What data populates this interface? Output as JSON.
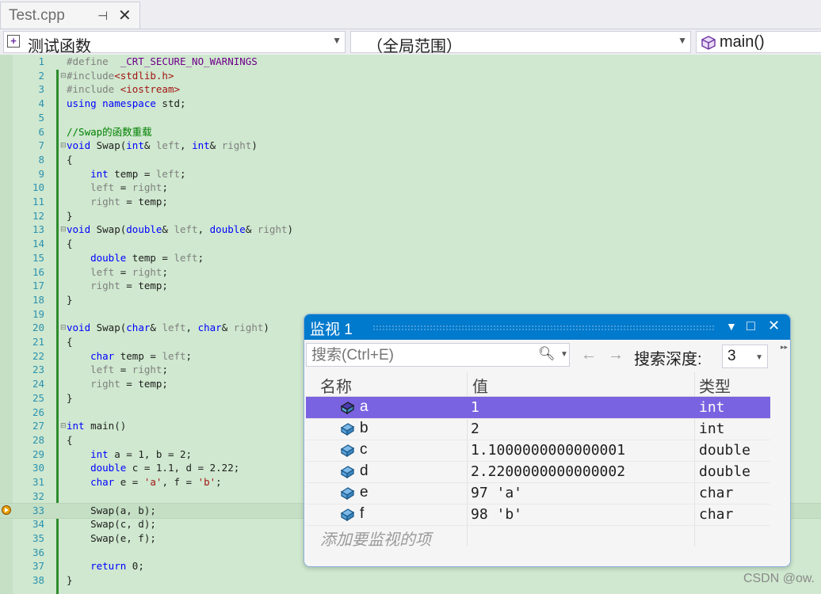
{
  "tab": {
    "title": "Test.cpp"
  },
  "nav": {
    "scope_label": "测试函数",
    "global_label": "（全局范围）",
    "member_label": "main()"
  },
  "code_lines": [
    {
      "n": "1",
      "html": "<span class=\"pp\">#define  </span><span class=\"mac\">_CRT_SECURE_NO_WARNINGS</span>"
    },
    {
      "n": "2",
      "html": "<span class=\"pp\">#include</span><span class=\"str\">&lt;stdlib.h&gt;</span>"
    },
    {
      "n": "3",
      "html": "<span class=\"pp\">#include </span><span class=\"str\">&lt;iostream&gt;</span>"
    },
    {
      "n": "4",
      "html": "<span class=\"kw\">using namespace</span> std;"
    },
    {
      "n": "5",
      "html": ""
    },
    {
      "n": "6",
      "html": "<span class=\"cm\">//Swap的函数重载</span>"
    },
    {
      "n": "7",
      "html": "<span class=\"kw\">void</span> Swap(<span class=\"kw\">int</span>&amp; <span class=\"prm\">left</span>, <span class=\"kw\">int</span>&amp; <span class=\"prm\">right</span>)"
    },
    {
      "n": "8",
      "html": "{"
    },
    {
      "n": "9",
      "html": "    <span class=\"kw\">int</span> temp = <span class=\"prm\">left</span>;"
    },
    {
      "n": "10",
      "html": "    <span class=\"prm\">left</span> = <span class=\"prm\">right</span>;"
    },
    {
      "n": "11",
      "html": "    <span class=\"prm\">right</span> = temp;"
    },
    {
      "n": "12",
      "html": "}"
    },
    {
      "n": "13",
      "html": "<span class=\"kw\">void</span> Swap(<span class=\"kw\">double</span>&amp; <span class=\"prm\">left</span>, <span class=\"kw\">double</span>&amp; <span class=\"prm\">right</span>)"
    },
    {
      "n": "14",
      "html": "{"
    },
    {
      "n": "15",
      "html": "    <span class=\"kw\">double</span> temp = <span class=\"prm\">left</span>;"
    },
    {
      "n": "16",
      "html": "    <span class=\"prm\">left</span> = <span class=\"prm\">right</span>;"
    },
    {
      "n": "17",
      "html": "    <span class=\"prm\">right</span> = temp;"
    },
    {
      "n": "18",
      "html": "}"
    },
    {
      "n": "19",
      "html": ""
    },
    {
      "n": "20",
      "html": "<span class=\"kw\">void</span> Swap(<span class=\"kw\">char</span>&amp; <span class=\"prm\">left</span>, <span class=\"kw\">char</span>&amp; <span class=\"prm\">right</span>)"
    },
    {
      "n": "21",
      "html": "{"
    },
    {
      "n": "22",
      "html": "    <span class=\"kw\">char</span> temp = <span class=\"prm\">left</span>;"
    },
    {
      "n": "23",
      "html": "    <span class=\"prm\">left</span> = <span class=\"prm\">right</span>;"
    },
    {
      "n": "24",
      "html": "    <span class=\"prm\">right</span> = temp;"
    },
    {
      "n": "25",
      "html": "}"
    },
    {
      "n": "26",
      "html": ""
    },
    {
      "n": "27",
      "html": "<span class=\"kw\">int</span> main()"
    },
    {
      "n": "28",
      "html": "{"
    },
    {
      "n": "29",
      "html": "    <span class=\"kw\">int</span> a = 1, b = 2;"
    },
    {
      "n": "30",
      "html": "    <span class=\"kw\">double</span> c = 1.1, d = 2.22;"
    },
    {
      "n": "31",
      "html": "    <span class=\"kw\">char</span> e = <span class=\"str\">'a'</span>, f = <span class=\"str\">'b'</span>;"
    },
    {
      "n": "32",
      "html": ""
    },
    {
      "n": "33",
      "html": "    Swap(a, b);"
    },
    {
      "n": "34",
      "html": "    Swap(c, d);"
    },
    {
      "n": "35",
      "html": "    Swap(e, f);"
    },
    {
      "n": "36",
      "html": ""
    },
    {
      "n": "37",
      "html": "    <span class=\"kw\">return</span> 0;"
    },
    {
      "n": "38",
      "html": "}"
    }
  ],
  "current_line": "33",
  "watch": {
    "title": "监视 1",
    "search_placeholder": "搜索(Ctrl+E)",
    "depth_label": "搜索深度:",
    "depth_value": "3",
    "columns": {
      "name": "名称",
      "value": "值",
      "type": "类型"
    },
    "rows": [
      {
        "name": "a",
        "value": "1",
        "type": "int"
      },
      {
        "name": "b",
        "value": "2",
        "type": "int"
      },
      {
        "name": "c",
        "value": "1.1000000000000001",
        "type": "double"
      },
      {
        "name": "d",
        "value": "2.2200000000000002",
        "type": "double"
      },
      {
        "name": "e",
        "value": "97 'a'",
        "type": "char"
      },
      {
        "name": "f",
        "value": "98 'b'",
        "type": "char"
      }
    ],
    "selected_row": "a",
    "add_item_placeholder": "添加要监视的项"
  },
  "watermark": "CSDN @ow."
}
